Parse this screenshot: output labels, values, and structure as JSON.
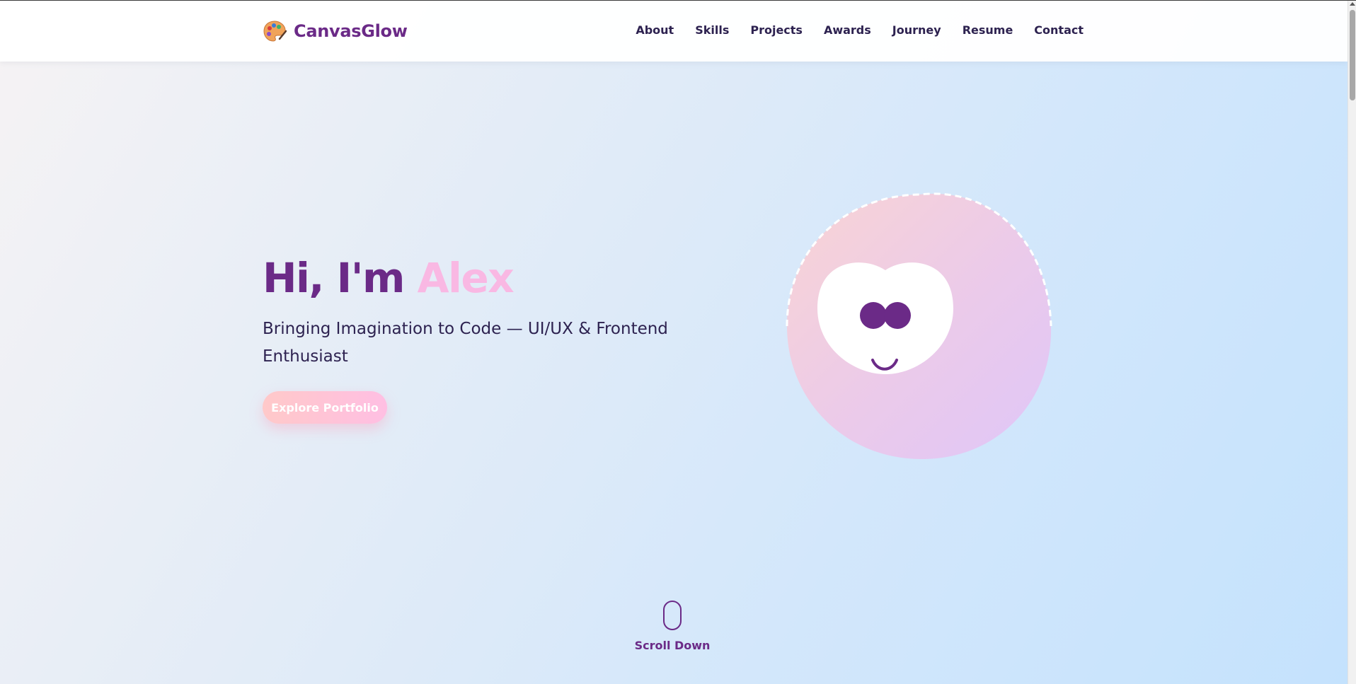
{
  "header": {
    "brand": "CanvasGlow",
    "nav": [
      "About",
      "Skills",
      "Projects",
      "Awards",
      "Journey",
      "Resume",
      "Contact"
    ]
  },
  "hero": {
    "greeting": "Hi, I'm ",
    "name": "Alex",
    "subtitle": "Bringing Imagination to Code — UI/UX & Frontend Enthusiast",
    "cta_label": "Explore Portfolio"
  },
  "scroll": {
    "label": "Scroll Down"
  },
  "icons": {
    "brand": "artist-palette-icon",
    "character": "smiling-heart-face-illustration",
    "scroll": "mouse-scroll-icon"
  },
  "colors": {
    "brand_purple": "#6b2a87",
    "accent_pink": "#f9b8e3",
    "text_dark": "#2d2250",
    "cta_gradient_start": "#ffc9c9",
    "cta_gradient_end": "#ffbfe3",
    "blob_gradient_start": "#f9d4d4",
    "blob_gradient_end": "#e2c6f7"
  }
}
